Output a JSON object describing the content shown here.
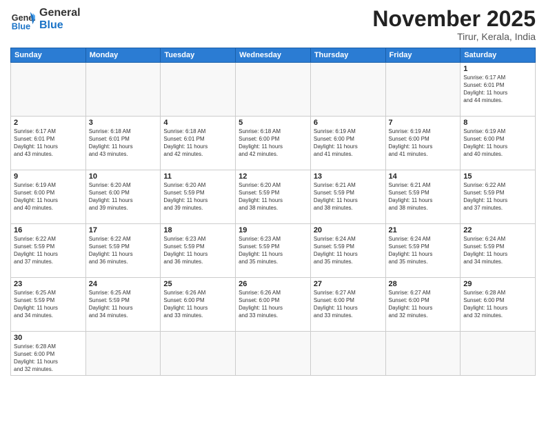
{
  "logo": {
    "text_general": "General",
    "text_blue": "Blue"
  },
  "header": {
    "month": "November 2025",
    "location": "Tirur, Kerala, India"
  },
  "weekdays": [
    "Sunday",
    "Monday",
    "Tuesday",
    "Wednesday",
    "Thursday",
    "Friday",
    "Saturday"
  ],
  "weeks": [
    [
      {
        "day": "",
        "info": ""
      },
      {
        "day": "",
        "info": ""
      },
      {
        "day": "",
        "info": ""
      },
      {
        "day": "",
        "info": ""
      },
      {
        "day": "",
        "info": ""
      },
      {
        "day": "",
        "info": ""
      },
      {
        "day": "1",
        "info": "Sunrise: 6:17 AM\nSunset: 6:01 PM\nDaylight: 11 hours\nand 44 minutes."
      }
    ],
    [
      {
        "day": "2",
        "info": "Sunrise: 6:17 AM\nSunset: 6:01 PM\nDaylight: 11 hours\nand 43 minutes."
      },
      {
        "day": "3",
        "info": "Sunrise: 6:18 AM\nSunset: 6:01 PM\nDaylight: 11 hours\nand 43 minutes."
      },
      {
        "day": "4",
        "info": "Sunrise: 6:18 AM\nSunset: 6:01 PM\nDaylight: 11 hours\nand 42 minutes."
      },
      {
        "day": "5",
        "info": "Sunrise: 6:18 AM\nSunset: 6:00 PM\nDaylight: 11 hours\nand 42 minutes."
      },
      {
        "day": "6",
        "info": "Sunrise: 6:19 AM\nSunset: 6:00 PM\nDaylight: 11 hours\nand 41 minutes."
      },
      {
        "day": "7",
        "info": "Sunrise: 6:19 AM\nSunset: 6:00 PM\nDaylight: 11 hours\nand 41 minutes."
      },
      {
        "day": "8",
        "info": "Sunrise: 6:19 AM\nSunset: 6:00 PM\nDaylight: 11 hours\nand 40 minutes."
      }
    ],
    [
      {
        "day": "9",
        "info": "Sunrise: 6:19 AM\nSunset: 6:00 PM\nDaylight: 11 hours\nand 40 minutes."
      },
      {
        "day": "10",
        "info": "Sunrise: 6:20 AM\nSunset: 6:00 PM\nDaylight: 11 hours\nand 39 minutes."
      },
      {
        "day": "11",
        "info": "Sunrise: 6:20 AM\nSunset: 5:59 PM\nDaylight: 11 hours\nand 39 minutes."
      },
      {
        "day": "12",
        "info": "Sunrise: 6:20 AM\nSunset: 5:59 PM\nDaylight: 11 hours\nand 38 minutes."
      },
      {
        "day": "13",
        "info": "Sunrise: 6:21 AM\nSunset: 5:59 PM\nDaylight: 11 hours\nand 38 minutes."
      },
      {
        "day": "14",
        "info": "Sunrise: 6:21 AM\nSunset: 5:59 PM\nDaylight: 11 hours\nand 38 minutes."
      },
      {
        "day": "15",
        "info": "Sunrise: 6:22 AM\nSunset: 5:59 PM\nDaylight: 11 hours\nand 37 minutes."
      }
    ],
    [
      {
        "day": "16",
        "info": "Sunrise: 6:22 AM\nSunset: 5:59 PM\nDaylight: 11 hours\nand 37 minutes."
      },
      {
        "day": "17",
        "info": "Sunrise: 6:22 AM\nSunset: 5:59 PM\nDaylight: 11 hours\nand 36 minutes."
      },
      {
        "day": "18",
        "info": "Sunrise: 6:23 AM\nSunset: 5:59 PM\nDaylight: 11 hours\nand 36 minutes."
      },
      {
        "day": "19",
        "info": "Sunrise: 6:23 AM\nSunset: 5:59 PM\nDaylight: 11 hours\nand 35 minutes."
      },
      {
        "day": "20",
        "info": "Sunrise: 6:24 AM\nSunset: 5:59 PM\nDaylight: 11 hours\nand 35 minutes."
      },
      {
        "day": "21",
        "info": "Sunrise: 6:24 AM\nSunset: 5:59 PM\nDaylight: 11 hours\nand 35 minutes."
      },
      {
        "day": "22",
        "info": "Sunrise: 6:24 AM\nSunset: 5:59 PM\nDaylight: 11 hours\nand 34 minutes."
      }
    ],
    [
      {
        "day": "23",
        "info": "Sunrise: 6:25 AM\nSunset: 5:59 PM\nDaylight: 11 hours\nand 34 minutes."
      },
      {
        "day": "24",
        "info": "Sunrise: 6:25 AM\nSunset: 5:59 PM\nDaylight: 11 hours\nand 34 minutes."
      },
      {
        "day": "25",
        "info": "Sunrise: 6:26 AM\nSunset: 6:00 PM\nDaylight: 11 hours\nand 33 minutes."
      },
      {
        "day": "26",
        "info": "Sunrise: 6:26 AM\nSunset: 6:00 PM\nDaylight: 11 hours\nand 33 minutes."
      },
      {
        "day": "27",
        "info": "Sunrise: 6:27 AM\nSunset: 6:00 PM\nDaylight: 11 hours\nand 33 minutes."
      },
      {
        "day": "28",
        "info": "Sunrise: 6:27 AM\nSunset: 6:00 PM\nDaylight: 11 hours\nand 32 minutes."
      },
      {
        "day": "29",
        "info": "Sunrise: 6:28 AM\nSunset: 6:00 PM\nDaylight: 11 hours\nand 32 minutes."
      }
    ],
    [
      {
        "day": "30",
        "info": "Sunrise: 6:28 AM\nSunset: 6:00 PM\nDaylight: 11 hours\nand 32 minutes."
      },
      {
        "day": "",
        "info": ""
      },
      {
        "day": "",
        "info": ""
      },
      {
        "day": "",
        "info": ""
      },
      {
        "day": "",
        "info": ""
      },
      {
        "day": "",
        "info": ""
      },
      {
        "day": "",
        "info": ""
      }
    ]
  ]
}
